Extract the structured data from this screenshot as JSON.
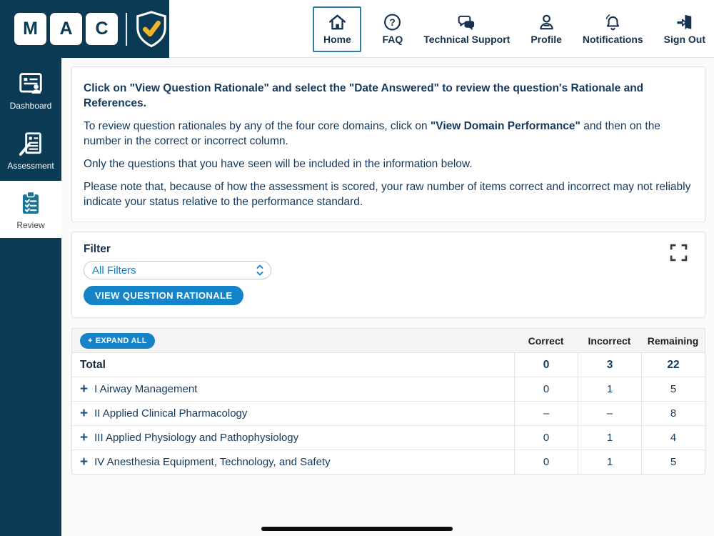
{
  "colors": {
    "brand_navy": "#0b3a55",
    "accent_blue": "#1583c7",
    "active_border_teal": "#2e7ea6",
    "text_navy": "#14395c"
  },
  "logo": {
    "letters": [
      "M",
      "A",
      "C"
    ],
    "badge_icon": "shield-check-icon"
  },
  "nav": {
    "items": [
      {
        "label": "Home",
        "icon": "home-icon",
        "active": true
      },
      {
        "label": "FAQ",
        "icon": "question-circle-icon"
      },
      {
        "label": "Technical Support",
        "icon": "chat-bubbles-icon"
      },
      {
        "label": "Profile",
        "icon": "person-icon"
      },
      {
        "label": "Notifications",
        "icon": "bell-icon"
      },
      {
        "label": "Sign Out",
        "icon": "door-exit-icon"
      }
    ]
  },
  "sidebar": {
    "items": [
      {
        "label": "Dashboard",
        "icon": "dashboard-icon"
      },
      {
        "label": "Assessment",
        "icon": "assessment-icon"
      },
      {
        "label": "Review",
        "icon": "review-clipboard-icon",
        "active": true
      }
    ]
  },
  "info": {
    "p1": "Click on \"View Question Rationale\" and select the \"Date Answered\" to review the question's Rationale and References.",
    "p2_prefix": "To review question rationales by any of the four core domains, click on ",
    "p2_bold": "\"View Domain Performance\"",
    "p2_suffix": " and then on the number in the correct or incorrect column.",
    "p3": "Only the questions that you have seen will be included in the information below.",
    "p4": "Please note that, because of how the assessment is scored, your raw number of items correct and incorrect may not reliably indicate your status relative to the performance standard."
  },
  "filter": {
    "label": "Filter",
    "selected_option": "All Filters",
    "button_label": "VIEW QUESTION RATIONALE"
  },
  "table": {
    "plus_glyph": "+",
    "expand_all_label": "EXPAND ALL",
    "columns": [
      "Correct",
      "Incorrect",
      "Remaining"
    ],
    "total": {
      "name": "Total",
      "correct": "0",
      "incorrect": "3",
      "remaining": "22"
    },
    "rows": [
      {
        "name": "I Airway Management",
        "correct": "0",
        "incorrect": "1",
        "remaining": "5"
      },
      {
        "name": "II Applied Clinical Pharmacology",
        "correct": "–",
        "incorrect": "–",
        "remaining": "8"
      },
      {
        "name": "III Applied Physiology and Pathophysiology",
        "correct": "0",
        "incorrect": "1",
        "remaining": "4"
      },
      {
        "name": "IV Anesthesia Equipment, Technology, and Safety",
        "correct": "0",
        "incorrect": "1",
        "remaining": "5"
      }
    ]
  }
}
